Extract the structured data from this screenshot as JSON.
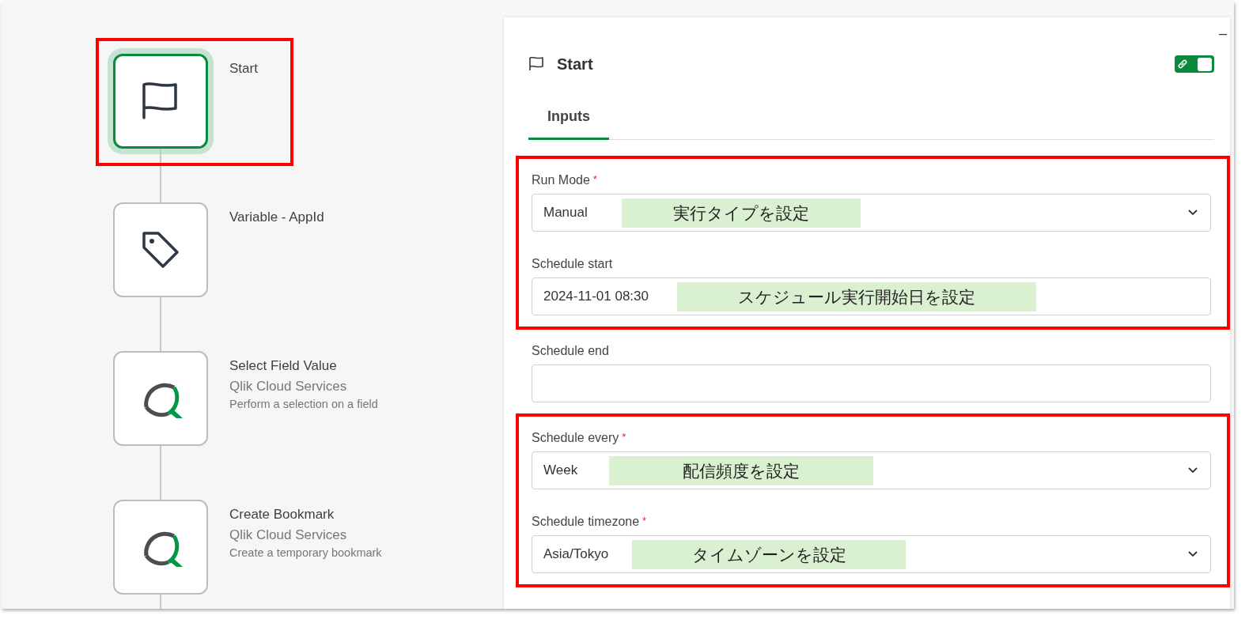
{
  "flow": {
    "nodes": [
      {
        "kind": "flag",
        "title": "Start",
        "selected": true,
        "highlighted": true
      },
      {
        "kind": "tag",
        "title": "Variable - AppId",
        "selected": false,
        "highlighted": false
      },
      {
        "kind": "qlik",
        "title": "Select Field Value",
        "service": "Qlik Cloud Services",
        "description": "Perform a selection on a field",
        "selected": false,
        "highlighted": false
      },
      {
        "kind": "qlik",
        "title": "Create Bookmark",
        "service": "Qlik Cloud Services",
        "description": "Create a temporary bookmark",
        "selected": false,
        "highlighted": false
      }
    ]
  },
  "panel": {
    "title": "Start",
    "minimize": "–",
    "link_toggle": {
      "on": true
    },
    "tabs": [
      {
        "label": "Inputs",
        "selected": true
      }
    ],
    "field_groups": [
      {
        "highlighted": true,
        "fields": [
          {
            "kind": "select",
            "label": "Run Mode",
            "required_mark": "*",
            "value": "Manual",
            "annotation": "実行タイプを設定"
          },
          {
            "kind": "text",
            "label": "Schedule start",
            "value": "2024-11-01 08:30",
            "annotation": "スケジュール実行開始日を設定"
          }
        ]
      },
      {
        "highlighted": false,
        "fields": [
          {
            "kind": "text",
            "label": "Schedule end"
          }
        ]
      },
      {
        "highlighted": true,
        "fields": [
          {
            "kind": "select",
            "label": "Schedule every",
            "required_mark": "*",
            "value": "Week",
            "annotation": "配信頻度を設定"
          },
          {
            "kind": "select",
            "label": "Schedule timezone",
            "required_mark": "*",
            "value": "Asia/Tokyo",
            "annotation": "タイムゾーンを設定"
          }
        ]
      }
    ]
  }
}
